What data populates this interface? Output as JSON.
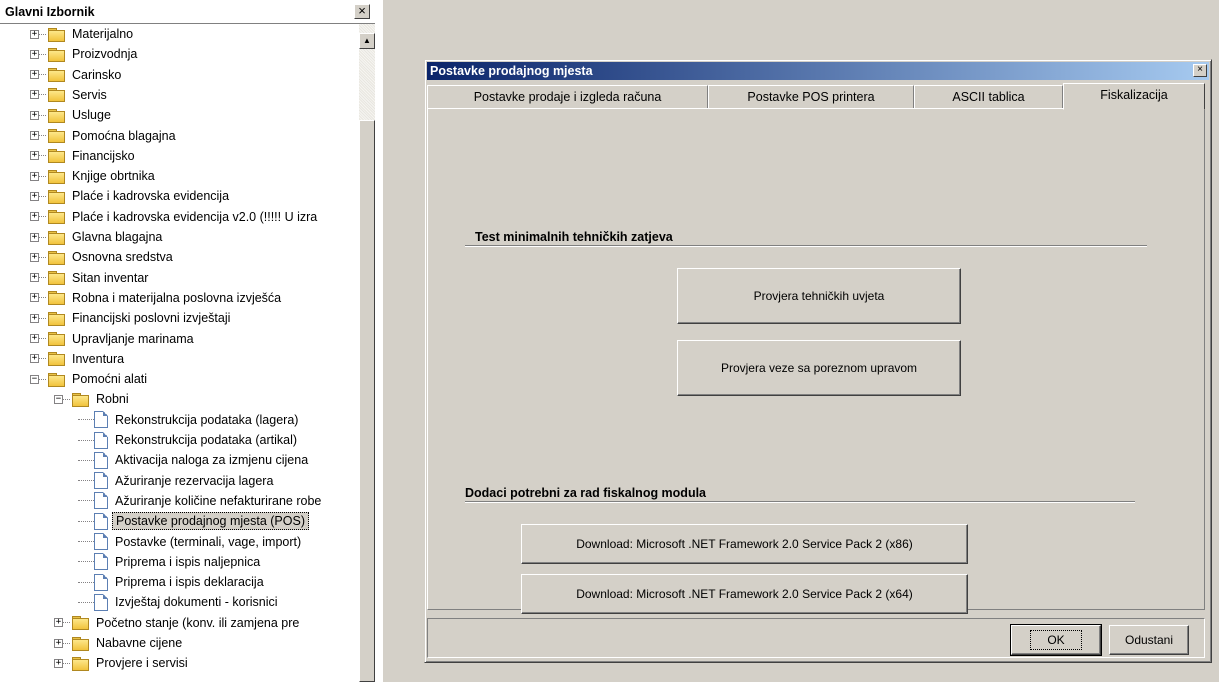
{
  "left_panel": {
    "title": "Glavni Izbornik",
    "close_glyph": "×",
    "items": [
      {
        "label": "Materijalno",
        "type": "folder",
        "level": 0,
        "state": "collapsed"
      },
      {
        "label": "Proizvodnja",
        "type": "folder",
        "level": 0,
        "state": "collapsed"
      },
      {
        "label": "Carinsko",
        "type": "folder",
        "level": 0,
        "state": "collapsed"
      },
      {
        "label": "Servis",
        "type": "folder",
        "level": 0,
        "state": "collapsed"
      },
      {
        "label": "Usluge",
        "type": "folder",
        "level": 0,
        "state": "collapsed"
      },
      {
        "label": "Pomoćna blagajna",
        "type": "folder",
        "level": 0,
        "state": "collapsed"
      },
      {
        "label": "Financijsko",
        "type": "folder",
        "level": 0,
        "state": "collapsed"
      },
      {
        "label": "Knjige obrtnika",
        "type": "folder",
        "level": 0,
        "state": "collapsed"
      },
      {
        "label": "Plaće i kadrovska evidencija",
        "type": "folder",
        "level": 0,
        "state": "collapsed"
      },
      {
        "label": "Plaće i kadrovska evidencija v2.0 (!!!!! U izra",
        "type": "folder",
        "level": 0,
        "state": "collapsed"
      },
      {
        "label": "Glavna blagajna",
        "type": "folder",
        "level": 0,
        "state": "collapsed"
      },
      {
        "label": "Osnovna sredstva",
        "type": "folder",
        "level": 0,
        "state": "collapsed"
      },
      {
        "label": "Sitan inventar",
        "type": "folder",
        "level": 0,
        "state": "collapsed"
      },
      {
        "label": "Robna i materijalna poslovna izvješća",
        "type": "folder",
        "level": 0,
        "state": "collapsed"
      },
      {
        "label": "Financijski poslovni izvještaji",
        "type": "folder",
        "level": 0,
        "state": "collapsed"
      },
      {
        "label": "Upravljanje marinama",
        "type": "folder",
        "level": 0,
        "state": "collapsed"
      },
      {
        "label": "Inventura",
        "type": "folder",
        "level": 0,
        "state": "collapsed"
      },
      {
        "label": "Pomoćni alati",
        "type": "folder",
        "level": 0,
        "state": "expanded"
      },
      {
        "label": "Robni",
        "type": "folder",
        "level": 1,
        "state": "expanded"
      },
      {
        "label": "Rekonstrukcija podataka (lagera)",
        "type": "doc",
        "level": 2
      },
      {
        "label": "Rekonstrukcija podataka (artikal)",
        "type": "doc",
        "level": 2
      },
      {
        "label": "Aktivacija naloga za izmjenu cijena",
        "type": "doc",
        "level": 2
      },
      {
        "label": "Ažuriranje rezervacija lagera",
        "type": "doc",
        "level": 2
      },
      {
        "label": "Ažuriranje količine nefakturirane robe",
        "type": "doc",
        "level": 2
      },
      {
        "label": "Postavke prodajnog mjesta (POS)",
        "type": "doc",
        "level": 2,
        "selected": true
      },
      {
        "label": "Postavke (terminali, vage, import)",
        "type": "doc",
        "level": 2
      },
      {
        "label": "Priprema i ispis naljepnica",
        "type": "doc",
        "level": 2
      },
      {
        "label": "Priprema i ispis deklaracija",
        "type": "doc",
        "level": 2
      },
      {
        "label": "Izvještaj dokumenti - korisnici",
        "type": "doc",
        "level": 2
      },
      {
        "label": "Početno stanje (konv. ili zamjena pre",
        "type": "folder",
        "level": 1,
        "state": "collapsed"
      },
      {
        "label": "Nabavne cijene",
        "type": "folder",
        "level": 1,
        "state": "collapsed"
      },
      {
        "label": "Provjere i servisi",
        "type": "folder",
        "level": 1,
        "state": "collapsed"
      }
    ]
  },
  "dialog": {
    "title": "Postavke prodajnog mjesta",
    "close_glyph": "×",
    "tabs": [
      {
        "label": "Postavke prodaje i izgleda računa",
        "active": false
      },
      {
        "label": "Postavke POS printera",
        "active": false
      },
      {
        "label": "ASCII tablica",
        "active": false
      },
      {
        "label": "Fiskalizacija",
        "active": true
      }
    ],
    "section_test": {
      "heading": "Test minimalnih tehničkih zatjeva",
      "btn_check_tech": "Provjera tehničkih uvjeta",
      "btn_check_tax": "Provjera veze sa poreznom upravom"
    },
    "section_addons": {
      "heading": "Dodaci potrebni za rad fiskalnog modula",
      "btn_x86": "Download: Microsoft .NET Framework 2.0 Service Pack 2 (x86)",
      "btn_x64": "Download: Microsoft .NET Framework 2.0 Service Pack 2 (x64)"
    },
    "ok_label": "OK",
    "cancel_label": "Odustani"
  }
}
